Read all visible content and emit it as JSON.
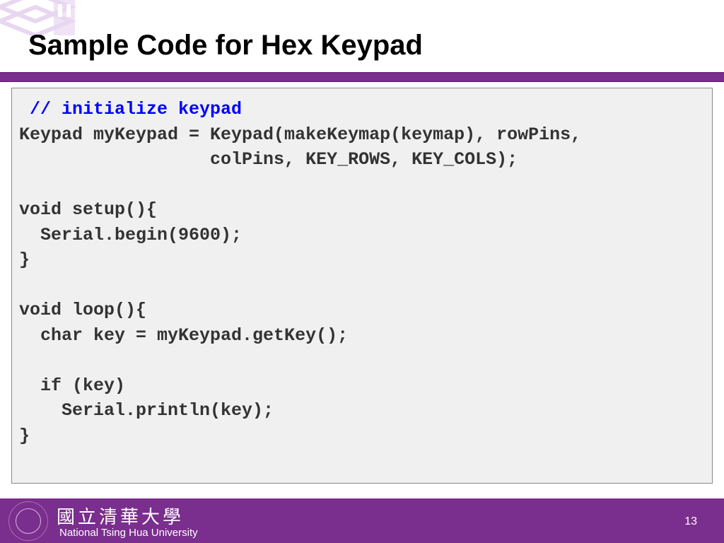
{
  "slide": {
    "title": "Sample Code for Hex Keypad",
    "page_number": "13"
  },
  "code": {
    "comment": " // initialize keypad",
    "line1": "Keypad myKeypad = Keypad(makeKeymap(keymap), rowPins,",
    "line2": "                  colPins, KEY_ROWS, KEY_COLS);",
    "line3": "",
    "line4": "void setup(){",
    "line5": "  Serial.begin(9600);",
    "line6": "}",
    "line7": "",
    "line8": "void loop(){",
    "line9": "  char key = myKeypad.getKey();",
    "line10": "",
    "line11": "  if (key)",
    "line12": "    Serial.println(key);",
    "line13": "}"
  },
  "footer": {
    "university_cn": "國立清華大學",
    "university_en": "National Tsing Hua University"
  }
}
